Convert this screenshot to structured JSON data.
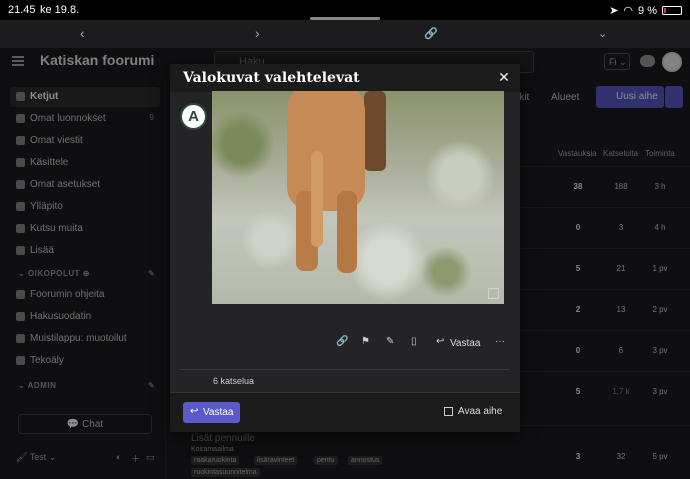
{
  "statusbar": {
    "time": "21.45",
    "date": "ke 19.8.",
    "battery": "9 %"
  },
  "header": {
    "title": "Katiskan foorumi",
    "search_placeholder": "Haku",
    "lang": "Fi"
  },
  "sidebar": {
    "items": [
      {
        "label": "Ketjut",
        "active": true
      },
      {
        "label": "Omat luonnokset",
        "count": "9"
      },
      {
        "label": "Omat viestit"
      },
      {
        "label": "Käsittele"
      },
      {
        "label": "Omat asetukset"
      },
      {
        "label": "Ylläpito"
      },
      {
        "label": "Kutsu muita"
      },
      {
        "label": "Lisää"
      }
    ],
    "section_shortcuts": "OIKOPOLUT",
    "shortcuts": [
      {
        "label": "Foorumin ohjeita"
      },
      {
        "label": "Hakusuodatin"
      },
      {
        "label": "Muistilappu: muotoilut"
      },
      {
        "label": "Tekoäly"
      }
    ],
    "section_admin": "ADMIN",
    "chat_label": "Chat",
    "footer_user": "Test"
  },
  "main": {
    "nav": [
      "rkit",
      "Alueet"
    ],
    "new_topic_label": "Uusi aihe",
    "columns": [
      "Vastauksia",
      "Katseluita",
      "Toiminta"
    ],
    "rows": [
      {
        "replies": "38",
        "views": "188",
        "activity": "3 h"
      },
      {
        "replies": "0",
        "views": "3",
        "activity": "4 h"
      },
      {
        "replies": "5",
        "views": "21",
        "activity": "1 pv"
      },
      {
        "replies": "2",
        "views": "13",
        "activity": "2 pv"
      },
      {
        "replies": "0",
        "views": "6",
        "activity": "3 pv"
      },
      {
        "replies": "5",
        "views": "1,7 k",
        "activity": "3 pv"
      },
      {
        "replies": "3",
        "views": "32",
        "activity": "5 pv"
      }
    ],
    "last_topic": {
      "title": "Lisät pennuille",
      "category": "Koiramaailma",
      "tags": [
        "raakaruokinta",
        "lisäravinteet",
        "pentu",
        "annostus",
        "ruokintasuunnitelma"
      ]
    }
  },
  "modal": {
    "title": "Valokuvat valehtelevat",
    "close": "✕",
    "reply_action_label": "Vastaa",
    "more": "···",
    "views_text": "6 katselua",
    "reply_button": "Vastaa",
    "open_topic": "Avaa aihe"
  }
}
